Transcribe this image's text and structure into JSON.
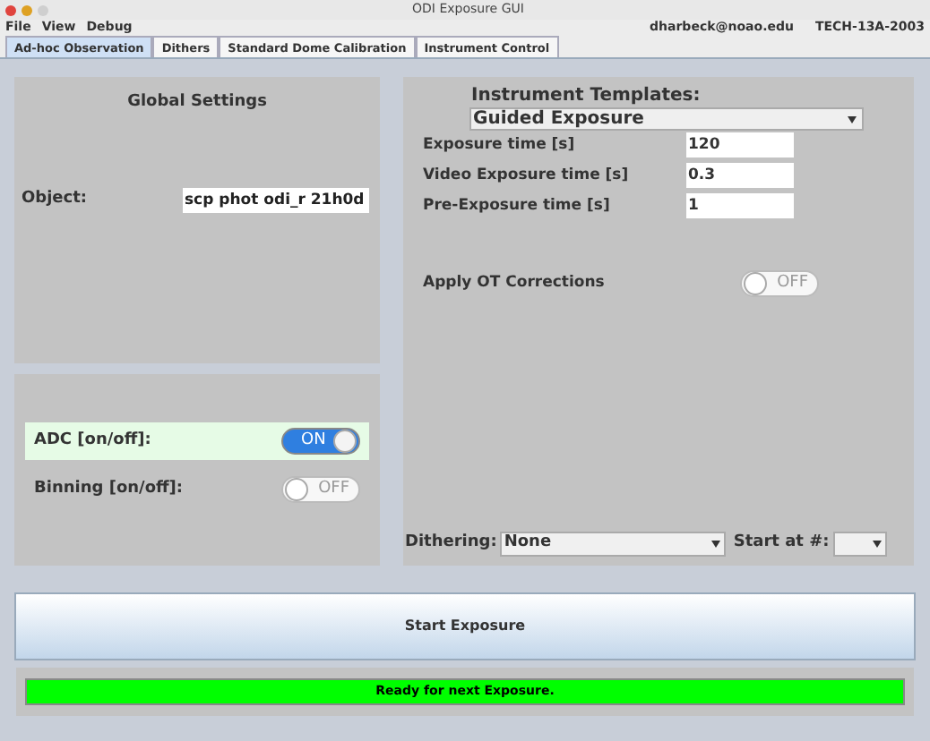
{
  "window": {
    "title": "ODI Exposure GUI"
  },
  "menu": [
    "File",
    "View",
    "Debug"
  ],
  "user": "dharbeck@noao.edu",
  "proposal": "TECH-13A-2003",
  "tabs": [
    {
      "label": "Ad-hoc Observation",
      "selected": true
    },
    {
      "label": "Dithers",
      "selected": false
    },
    {
      "label": "Standard Dome Calibration",
      "selected": false
    },
    {
      "label": "Instrument Control",
      "selected": false
    }
  ],
  "global_settings": {
    "title": "Global Settings",
    "object_label": "Object:",
    "object_value": "scp phot odi_r 21h0d"
  },
  "switches": [
    {
      "label": "ADC [on/off]:",
      "on": true,
      "text": "ON",
      "highlighted": true
    },
    {
      "label": "Binning [on/off]:",
      "on": false,
      "text": "OFF",
      "highlighted": false
    }
  ],
  "templates": {
    "label": "Instrument Templates:",
    "value": "Guided Exposure"
  },
  "fields": [
    {
      "label": "Exposure time [s]",
      "value": "120"
    },
    {
      "label": "Video Exposure time [s]",
      "value": "0.3"
    },
    {
      "label": "Pre-Exposure time [s]",
      "value": "1"
    }
  ],
  "ot_corrections": {
    "label": "Apply OT Corrections",
    "on": false,
    "text": "OFF"
  },
  "dithering": {
    "label": "Dithering:",
    "value": "None",
    "start_label": "Start at #:"
  },
  "start_button": "Start Exposure",
  "status": "Ready for next Exposure."
}
